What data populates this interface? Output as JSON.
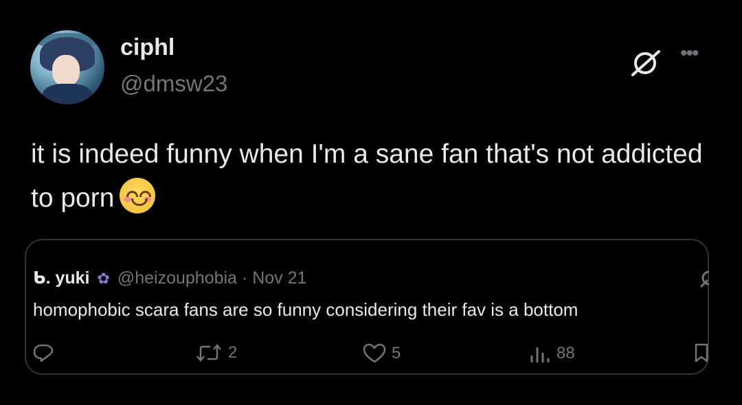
{
  "tweet": {
    "author": {
      "display_name": "ciphl",
      "handle": "@dmsw23"
    },
    "text": "it is indeed funny when I'm a sane fan that's not addicted to porn",
    "emoji_icon": "smiling-face-with-smiling-eyes-icon"
  },
  "quote": {
    "author_prefix": "ᑲ. yuki",
    "author_emoji": "hyacinth-icon",
    "handle": "@heizouphobia",
    "separator": "·",
    "date": "Nov 21",
    "text": "homophobic scara fans are so funny considering their fav is a bottom",
    "actions": {
      "reply_count": "",
      "retweet_count": "2",
      "like_count": "5",
      "view_count": "88"
    }
  },
  "icons": {
    "top_right_1": "grok-slash-icon",
    "top_right_2": "more-dots-icon"
  },
  "colors": {
    "background": "#000000",
    "text_primary": "#e7e9ea",
    "text_secondary": "#71767b",
    "border": "#2f3336"
  }
}
